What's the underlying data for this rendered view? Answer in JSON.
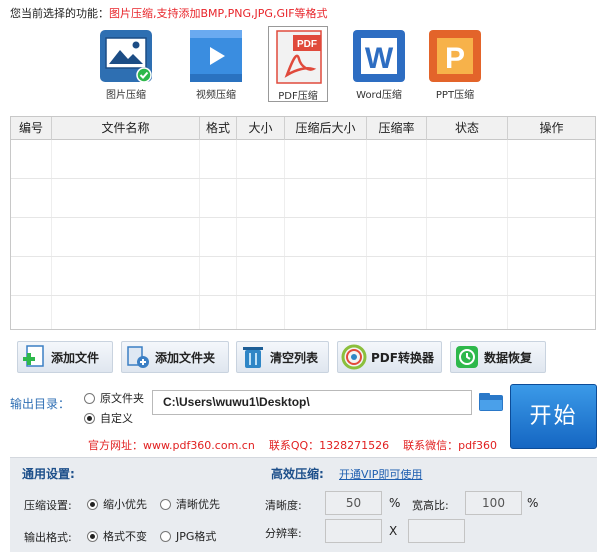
{
  "top": {
    "label": "您当前选择的功能：",
    "hint": "图片压缩,支持添加BMP,PNG,JPG,GIF等格式"
  },
  "tiles": [
    {
      "label": "图片压缩",
      "icon": "image-compress-icon",
      "color": "#2e6fb2"
    },
    {
      "label": "视频压缩",
      "icon": "video-compress-icon",
      "color": "#3a8de0"
    },
    {
      "label": "PDF压缩",
      "icon": "pdf-compress-icon",
      "color": "#e04a3c"
    },
    {
      "label": "Word压缩",
      "icon": "word-compress-icon",
      "color": "#2d6dc2"
    },
    {
      "label": "PPT压缩",
      "icon": "ppt-compress-icon",
      "color": "#e3642a"
    }
  ],
  "table": {
    "columns": [
      "编号",
      "文件名称",
      "格式",
      "大小",
      "压缩后大小",
      "压缩率",
      "状态",
      "操作"
    ],
    "rows": []
  },
  "actions": [
    {
      "label": "添加文件",
      "icon": "add-file-icon"
    },
    {
      "label": "添加文件夹",
      "icon": "add-folder-icon"
    },
    {
      "label": "清空列表",
      "icon": "clear-list-icon"
    },
    {
      "label": "PDF转换器",
      "icon": "pdf-converter-icon"
    },
    {
      "label": "数据恢复",
      "icon": "data-recovery-icon"
    }
  ],
  "output": {
    "label": "输出目录：",
    "option_original": "原文件夹",
    "option_custom": "自定义",
    "selected": "custom",
    "path": "C:\\Users\\wuwu1\\Desktop\\"
  },
  "start_label": "开始",
  "info": {
    "website": "官方网址：www.pdf360.com.cn",
    "qq": "联系QQ：1328271526",
    "wechat": "联系微信：pdf360"
  },
  "settings": {
    "general_title": "通用设置:",
    "efficient_title": "高效压缩:",
    "vip_link": "开通VIP即可使用",
    "compress_label": "压缩设置:",
    "compress_small": "缩小优先",
    "compress_clear": "清晰优先",
    "compress_selected": "small",
    "format_label": "输出格式:",
    "format_keep": "格式不变",
    "format_jpg": "JPG格式",
    "format_selected": "keep",
    "clarity_label": "清晰度:",
    "clarity_value": "50",
    "clarity_unit": "%",
    "ratio_label": "宽高比:",
    "ratio_value": "100",
    "ratio_unit": "%",
    "resolution_label": "分辨率:",
    "resolution_sep": "X"
  }
}
